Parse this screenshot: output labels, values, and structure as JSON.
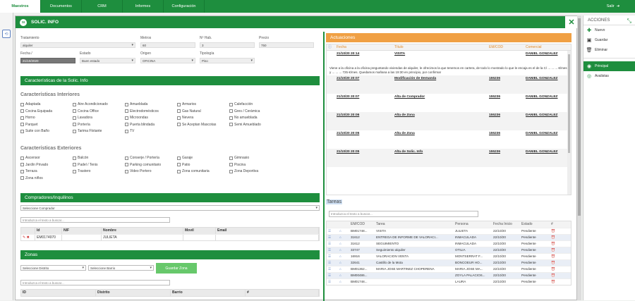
{
  "nav": {
    "tabs": [
      "Maestros",
      "Documentos",
      "CRM",
      "Informes",
      "Configuración"
    ],
    "exit": "Salir"
  },
  "modal": {
    "icon": "SI",
    "title": "SOLIC. INFO"
  },
  "form": {
    "tratamiento": {
      "label": "Tratamiento",
      "value": "alquiler"
    },
    "metros": {
      "label": "Metros",
      "value": "60"
    },
    "nhab": {
      "label": "Nº Hab.",
      "value": "3"
    },
    "precio": {
      "label": "Precio",
      "value": "750"
    },
    "fecha": {
      "label": "Fecha /",
      "value": "21/10/2020"
    },
    "estado": {
      "label": "Estado",
      "value": "Buen estado"
    },
    "origen": {
      "label": "Origen",
      "value": "OFICINA"
    },
    "tipologia": {
      "label": "Tipología",
      "value": "Piso"
    }
  },
  "caract": {
    "title": "Características de la Solic. Info",
    "interiores": "Características Interiores",
    "exteriores": "Características Exteriores",
    "int": [
      "Adaptada",
      "Aire Acondicionado",
      "Amueblada",
      "Armarios",
      "Calefacción",
      "Cocina Equipada",
      "Cocina Office",
      "Electrodomésticos",
      "Gas Natural",
      "Gres / Cerámica",
      "Horno",
      "Lavadora",
      "Microondas",
      "Nevera",
      "No amueblada",
      "Parquet",
      "Portería",
      "Puerta blindada",
      "Se Aceptan Mascotas",
      "Semi Amueblado",
      "Suite con Baño",
      "Tarima Flotante",
      "TV"
    ],
    "ext": [
      "Ascensor",
      "Balcón",
      "Conserje / Portería",
      "Garaje",
      "Gimnasio",
      "Jardín Privado",
      "Padel / Tenis",
      "Parking comunitario",
      "Patio",
      "Piscina",
      "Terraza",
      "Trastero",
      "Video Portero",
      "Zona comunitaria",
      "Zona Deportiva",
      "Zona niños"
    ]
  },
  "compradores": {
    "title": "Compradores/Inquilinos",
    "select": "Seleccione Comprador",
    "search": "Introduzca el texto a buscar...",
    "cols": [
      "",
      "Id",
      "NIF",
      "Nombre",
      "Movil",
      "Email"
    ],
    "rows": [
      [
        "",
        "EM0174970",
        "",
        "JULIETA",
        "",
        ""
      ]
    ]
  },
  "zonas": {
    "title": "Zonas",
    "distrito": "Seleccione Distrito",
    "barrio": "Seleccione Barrio",
    "btn": "Guardar Zona",
    "search": "Introduzca el texto a buscar...",
    "cols": [
      "ID",
      "Distrito",
      "Barrio",
      "#"
    ]
  },
  "actuaciones": {
    "title": "Actuaciones",
    "cols": [
      "",
      "Fecha",
      "Título",
      "EM/COD",
      "Comercial"
    ],
    "desc": "Viene a la oficina a la oficina preguntando viviendas de alquiler, le ofrecimos la que tenemos en cartera, de todo lo mostrado lo que le encaja es el de la C/ ... ... ... €/mes y ... ... ... 725 €/mes. Quedamos mañana a las 19:30 en principio, por confirmar",
    "rows": [
      {
        "fecha": "21/10/20 20:14",
        "titulo": "VISITA",
        "cod": "",
        "com": "DANIEL GONZALEZ"
      },
      {
        "fecha": "21/10/20 20:07",
        "titulo": "Modificación de Demanda",
        "cod": "155236",
        "com": "DANIEL GONZALEZ"
      },
      {
        "fecha": "21/10/20 20:07",
        "titulo": "Alta de Comprador",
        "cod": "155236",
        "com": "DANIEL GONZALEZ"
      },
      {
        "fecha": "21/10/20 20:06",
        "titulo": "Alta de Zona",
        "cod": "155236",
        "com": "DANIEL GONZALEZ"
      },
      {
        "fecha": "21/10/20 20:05",
        "titulo": "Alta de Zona",
        "cod": "155236",
        "com": "DANIEL GONZALEZ"
      },
      {
        "fecha": "21/10/20 20:05",
        "titulo": "Alta de Solic. Info",
        "cod": "155236",
        "com": "DANIEL GONZALEZ"
      }
    ]
  },
  "tareas": {
    "title": "Tareas",
    "search": "Introduzca el texto a buscar...",
    "cols": [
      "",
      "",
      "EM/COD",
      "Tarea",
      "Persona",
      "Fecha Inicio",
      "Estado",
      "#"
    ],
    "rows": [
      [
        "BM01748...",
        "VISITA",
        "JULIETA",
        "22/10/20",
        "Pendiente"
      ],
      [
        "31612",
        "ENTREGA DE INFORME DE VALORACI...",
        "INMACULADA",
        "22/10/20",
        "Pendiente"
      ],
      [
        "31612",
        "SEGUIMIENTO",
        "INMACULADA",
        "22/10/20",
        "Pendiente"
      ],
      [
        "33747",
        "Seguimiento alquiler",
        "OTILIA",
        "22/10/20",
        "Pendiente"
      ],
      [
        "16916",
        "VALORACION VENTA",
        "MONTSERRAT F...",
        "22/10/20",
        "Pendiente"
      ],
      [
        "32641",
        "Castillo de la Mota",
        "BONCOEUR HO...",
        "22/10/20",
        "Pendiente"
      ],
      [
        "BM01362...",
        "MARIA JOSE MARTINEZ CHOPERENA",
        "MARIA JOSE MA...",
        "22/10/20",
        "Pendiente"
      ],
      [
        "BM00486...",
        "",
        "ZOYLA PALACIOS...",
        "22/10/20",
        "Pendiente"
      ],
      [
        "BM01748...",
        "",
        "LAURA",
        "22/10/20",
        "Pendiente"
      ]
    ]
  },
  "acciones": {
    "title": "ACCIONES",
    "items": [
      "Nuevo",
      "Guardar",
      "Eliminar"
    ],
    "principal": "Principal",
    "avalistas": "Avalistas"
  }
}
